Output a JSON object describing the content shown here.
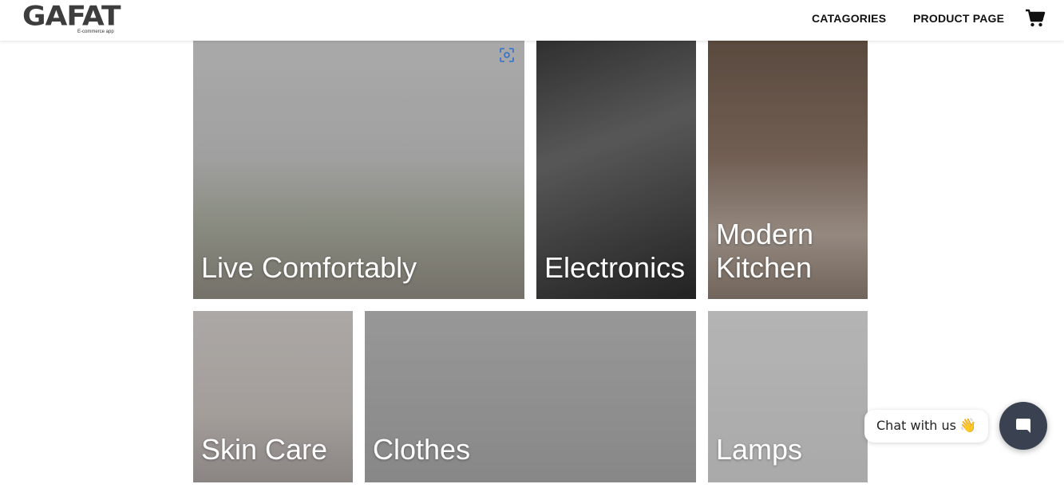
{
  "header": {
    "logo": "GAFAT",
    "logo_sub": "E-commerce app",
    "nav": {
      "categories": "CATAGORIES",
      "product_page": "PRODUCT PAGE"
    },
    "cart_icon": "shopping-cart-icon"
  },
  "categories": [
    {
      "label": "Live Comfortably"
    },
    {
      "label": "Electronics"
    },
    {
      "label": "Modern Kitchen"
    },
    {
      "label": "Skin Care"
    },
    {
      "label": "Clothes"
    },
    {
      "label": "Lamps"
    }
  ],
  "chat": {
    "prompt": "Chat with us",
    "emoji": "👋",
    "button_icon": "chat-icon"
  },
  "colors": {
    "chat_button": "#3a4150",
    "nav_text": "#111111"
  }
}
